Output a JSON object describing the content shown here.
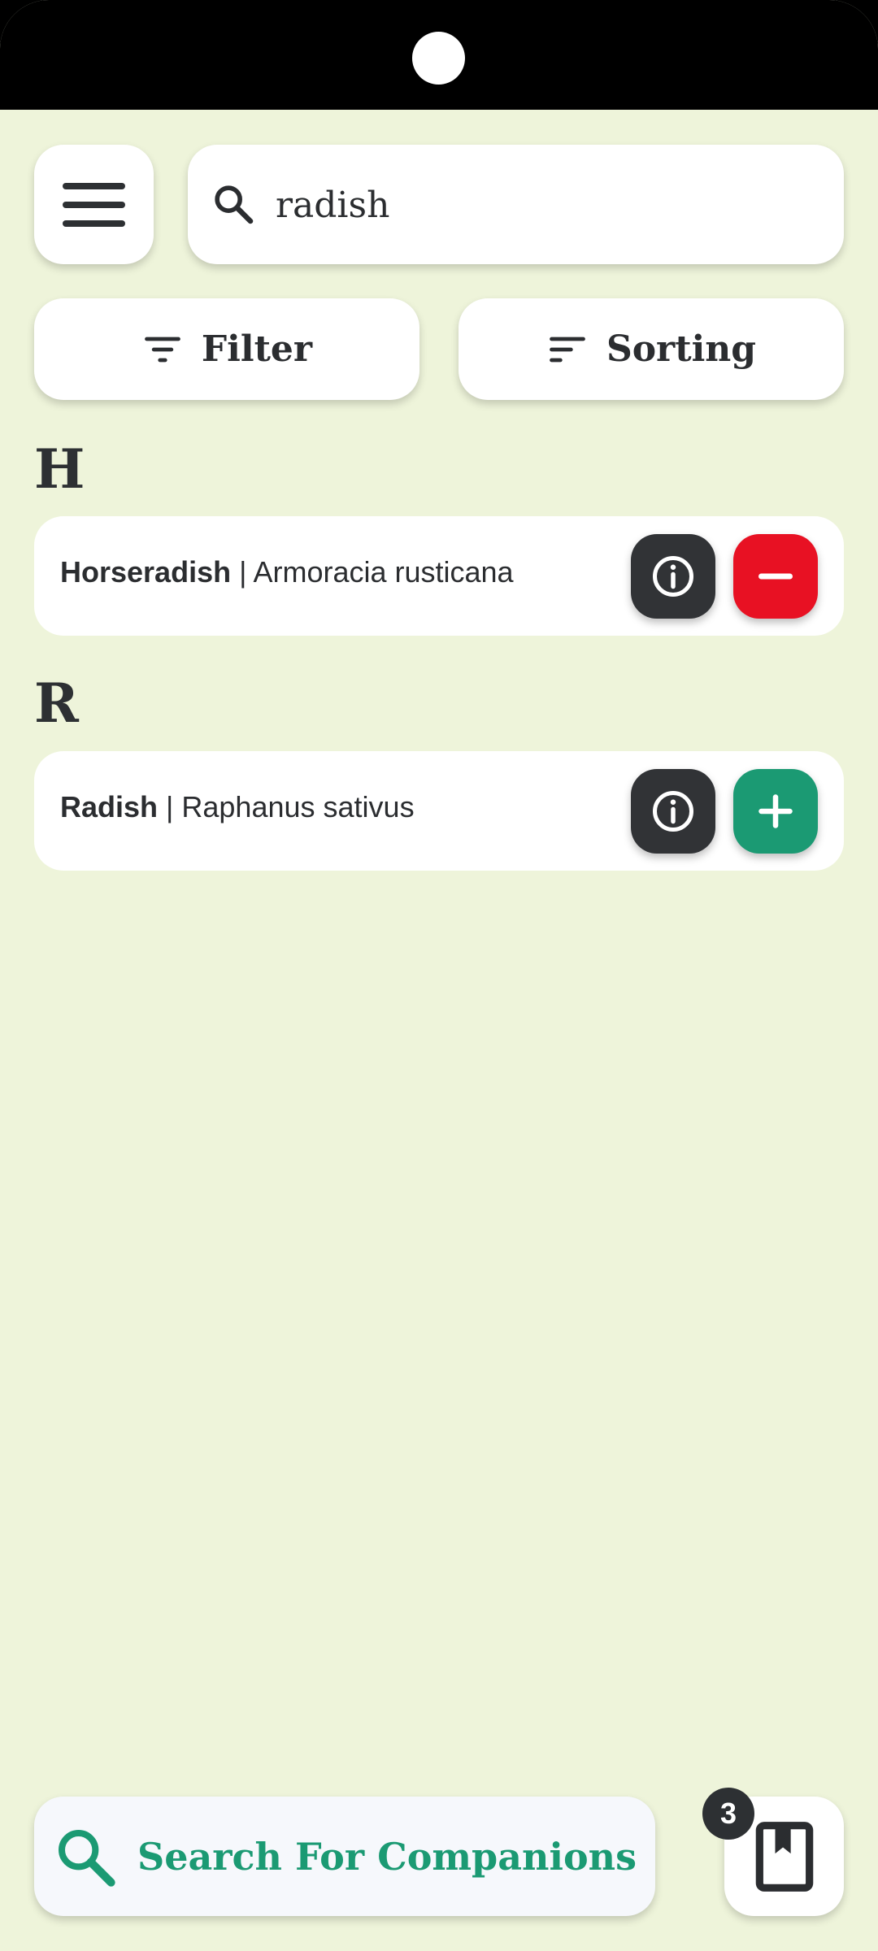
{
  "search": {
    "value": "radish",
    "icon": "search-icon"
  },
  "toolbar": {
    "filter_label": "Filter",
    "sorting_label": "Sorting"
  },
  "sections": [
    {
      "letter": "H",
      "items": [
        {
          "common_name": "Horseradish",
          "separator": " | ",
          "latin_name": "Armoracia rusticana",
          "action": "remove",
          "action_color": "#e81123"
        }
      ]
    },
    {
      "letter": "R",
      "items": [
        {
          "common_name": "Radish",
          "separator": " | ",
          "latin_name": "Raphanus sativus",
          "action": "add",
          "action_color": "#1b9a73"
        }
      ]
    }
  ],
  "bottom": {
    "companions_label": "Search For Companions",
    "bookmark_count": "3"
  },
  "colors": {
    "background": "#eef4da",
    "accent": "#1b9a73",
    "remove": "#e81123",
    "dark": "#313336"
  }
}
